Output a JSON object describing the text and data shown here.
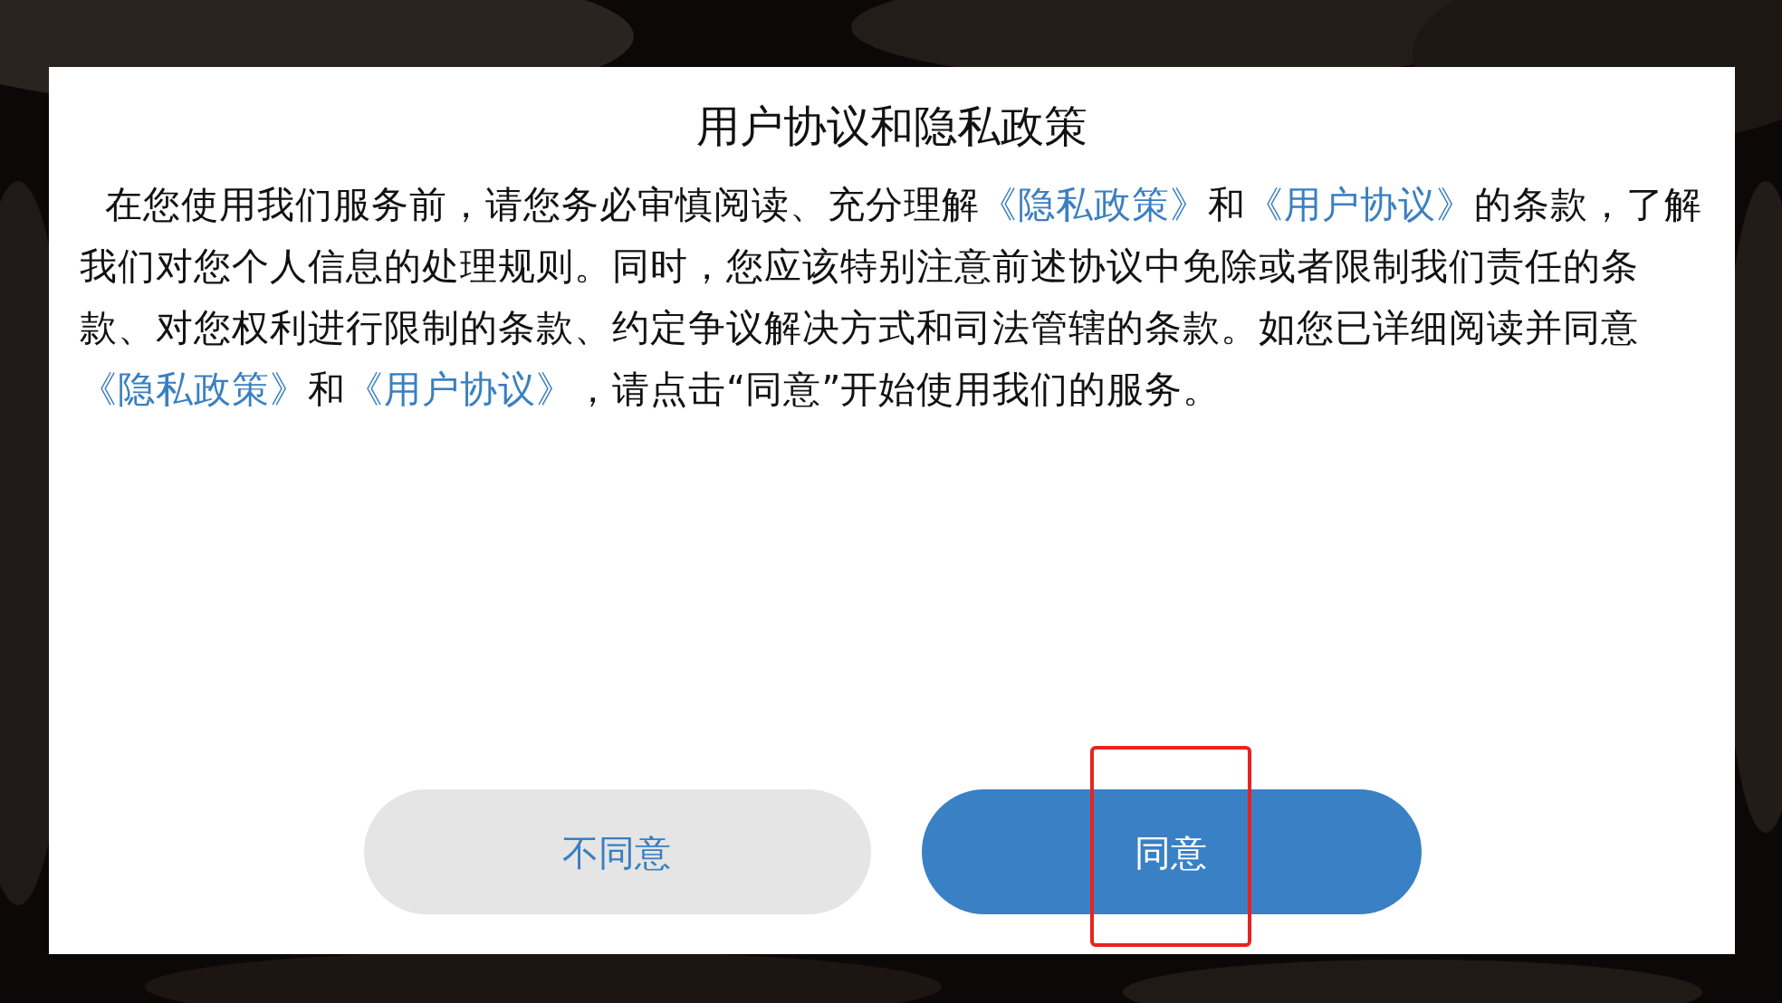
{
  "dialog": {
    "title": "用户协议和隐私政策",
    "body": [
      {
        "kind": "text",
        "text": "在您使用我们服务前，请您务必审慎阅读、充分理解"
      },
      {
        "kind": "link",
        "text": "《隐私政策》"
      },
      {
        "kind": "text",
        "text": "和"
      },
      {
        "kind": "link",
        "text": "《用户协议》"
      },
      {
        "kind": "text",
        "text": "的条款，了解我们对您个人信息的处理规则。同时，您应该特别注意前述协议中免除或者限制我们责任的条款、对您权利进行限制的条款、约定争议解决方式和司法管辖的条款。如您已详细阅读并同意"
      },
      {
        "kind": "link",
        "text": "《隐私政策》"
      },
      {
        "kind": "text",
        "text": "和"
      },
      {
        "kind": "link",
        "text": "《用户协议》"
      },
      {
        "kind": "text",
        "text": "，请点击“同意”开始使用我们的服务。"
      }
    ],
    "buttons": [
      {
        "label": "不同意",
        "kind": "secondary",
        "highlighted": false
      },
      {
        "label": "同意",
        "kind": "primary",
        "highlighted": true
      }
    ]
  }
}
